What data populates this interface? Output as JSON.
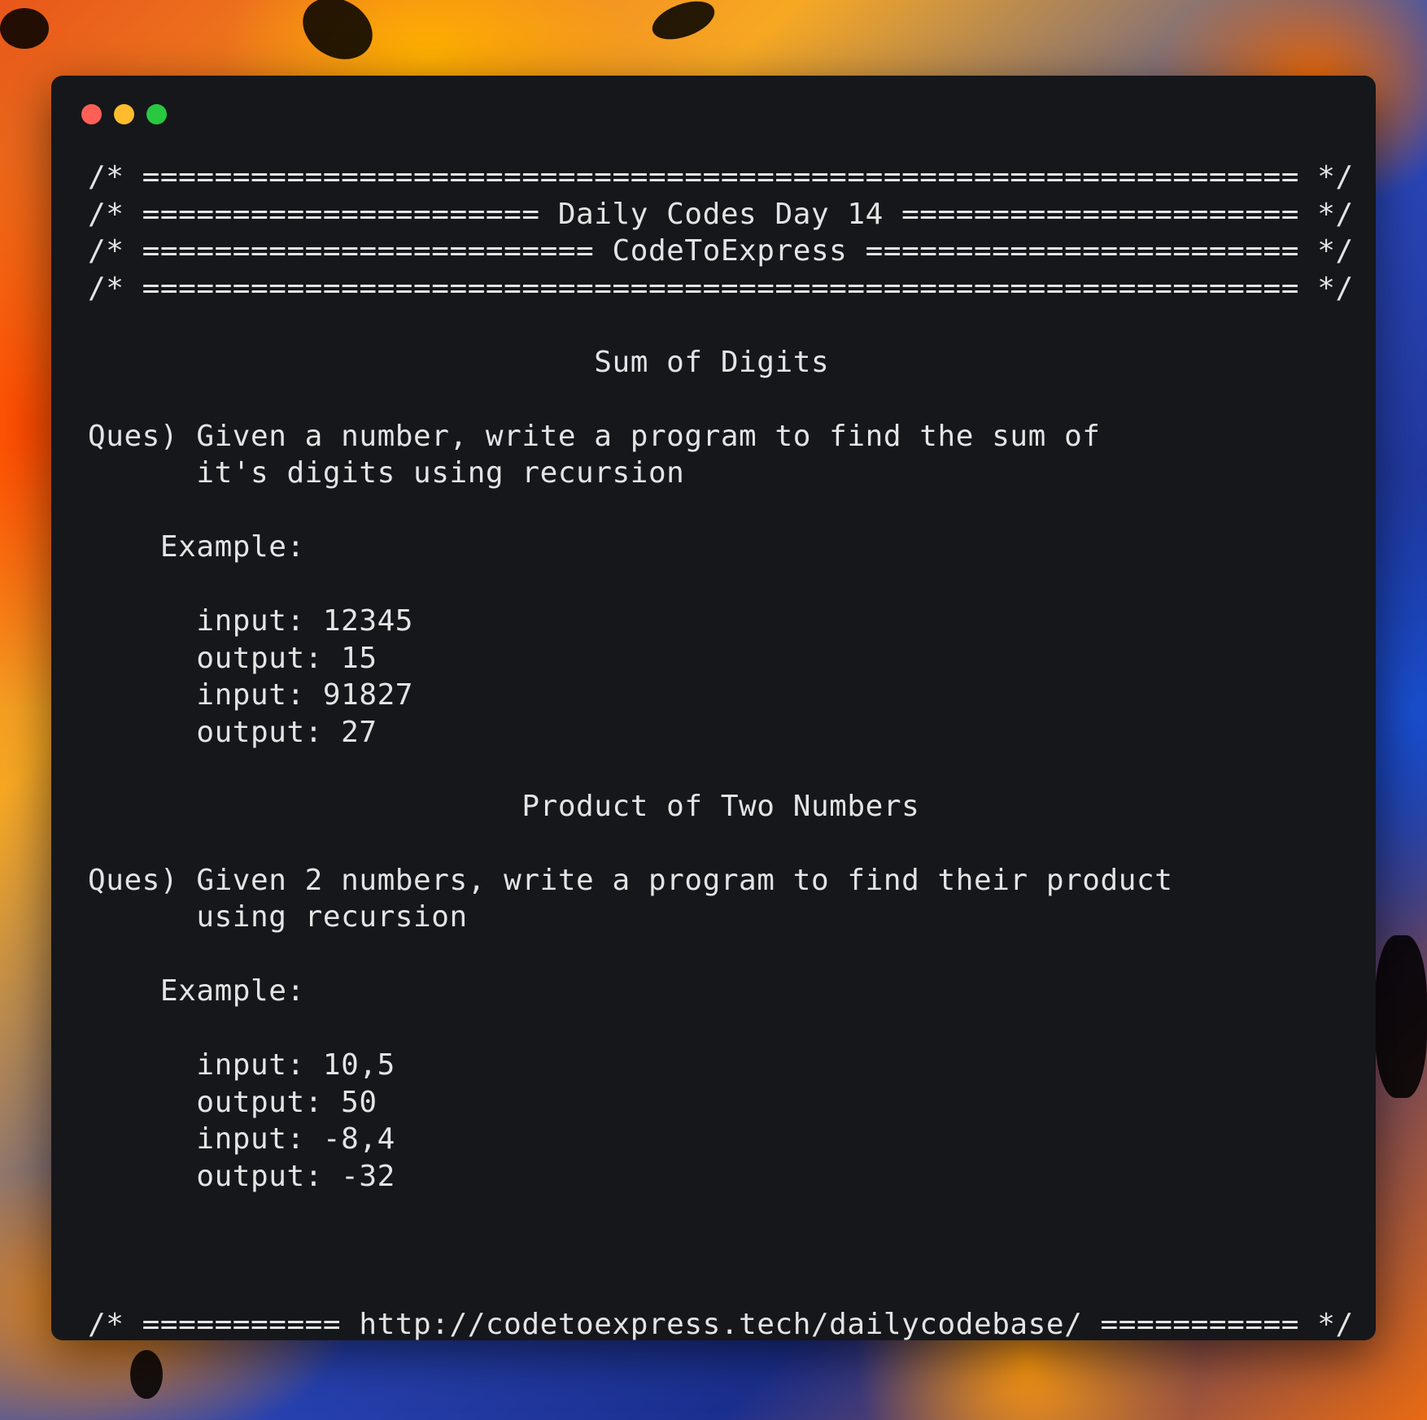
{
  "background": {
    "colors": [
      "#ff8a00",
      "#f7a823",
      "#2a46b8",
      "#1b2f8f",
      "#e8571a"
    ]
  },
  "window": {
    "background_color": "#16171a",
    "controls": [
      {
        "name": "close",
        "color": "#ff5f57"
      },
      {
        "name": "minimize",
        "color": "#febc2e"
      },
      {
        "name": "zoom",
        "color": "#28c840"
      }
    ]
  },
  "code": {
    "header": [
      "/* ================================================================ */",
      "/* ====================== Daily Codes Day 14 ====================== */",
      "/* ========================= CodeToExpress ======================== */",
      "/* ================================================================ */"
    ],
    "section1": {
      "title": "                            Sum of Digits",
      "question_line1": "Ques) Given a number, write a program to find the sum of",
      "question_line2": "      it's digits using recursion",
      "example_label": "    Example:",
      "examples": [
        "      input: 12345",
        "      output: 15",
        "      input: 91827",
        "      output: 27"
      ]
    },
    "section2": {
      "title": "                        Product of Two Numbers",
      "question_line1": "Ques) Given 2 numbers, write a program to find their product",
      "question_line2": "      using recursion",
      "example_label": "    Example:",
      "examples": [
        "      input: 10,5",
        "      output: 50",
        "      input: -8,4",
        "      output: -32"
      ]
    },
    "footer": "/* =========== http://codetoexpress.tech/dailycodebase/ =========== */"
  }
}
